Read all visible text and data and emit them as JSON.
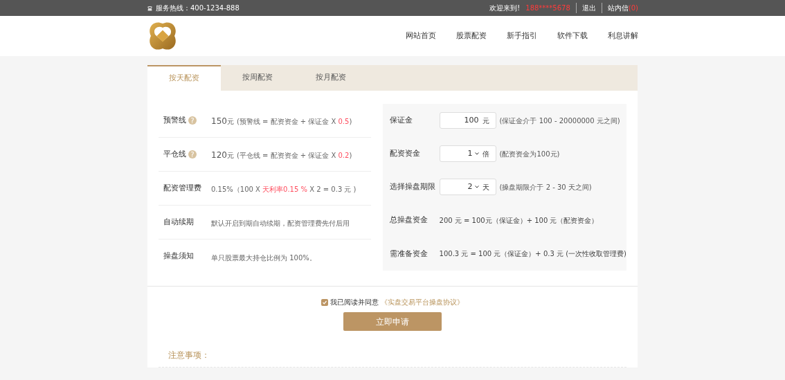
{
  "top_bar": {
    "hotline_label": "服务热线：",
    "hotline": "400-1234-888",
    "welcome": "欢迎来到!",
    "user": "188****5678",
    "logout": "退出",
    "inbox": "站内信",
    "inbox_count": "(0)"
  },
  "nav": [
    {
      "label": "网站首页"
    },
    {
      "label": "股票配资"
    },
    {
      "label": "新手指引"
    },
    {
      "label": "软件下载"
    },
    {
      "label": "利息讲解"
    }
  ],
  "tabs": [
    {
      "label": "按天配资",
      "selected": true
    },
    {
      "label": "按周配资",
      "selected": false
    },
    {
      "label": "按月配资",
      "selected": false
    }
  ],
  "info_rows": [
    {
      "label": "预警线",
      "help": "?",
      "segments": [
        {
          "kind": "amount",
          "text": "150"
        },
        {
          "kind": "unit",
          "text": "元"
        },
        {
          "kind": "note",
          "text": "(预警线 = 配资资金 + 保证金 X "
        },
        {
          "kind": "red",
          "text": "0.5"
        },
        {
          "kind": "note",
          "text": ")"
        }
      ]
    },
    {
      "label": "平仓线",
      "help": "?",
      "segments": [
        {
          "kind": "amount",
          "text": "120"
        },
        {
          "kind": "unit",
          "text": "元"
        },
        {
          "kind": "note",
          "text": "(平仓线 = 配资资金 + 保证金 X "
        },
        {
          "kind": "red",
          "text": "0.2"
        },
        {
          "kind": "note",
          "text": ")"
        }
      ]
    },
    {
      "label": "配资管理费",
      "segments": [
        {
          "kind": "plain",
          "text": "0.15%"
        },
        {
          "kind": "plain",
          "text": "（100 X "
        },
        {
          "kind": "red",
          "text": "天利率0.15 %"
        },
        {
          "kind": "plain",
          "text": " X 2 = 0.3 元 )"
        }
      ]
    },
    {
      "label": "自动续期",
      "segments": [
        {
          "kind": "plain",
          "text": "默认开启到期自动续期，配资管理费先付后用"
        }
      ]
    },
    {
      "label": "操盘须知",
      "segments": [
        {
          "kind": "plain",
          "text": "单只股票最大持仓比例为 100%。"
        }
      ]
    }
  ],
  "form_rows": [
    {
      "kind": "input",
      "label": "保证金",
      "value": "100",
      "unit": "元",
      "hint": "(保证金介于 100 - 20000000 元之间)"
    },
    {
      "kind": "select",
      "label": "配资资金",
      "value": "1",
      "unit": "倍",
      "hint": "(配资资金为100元)"
    },
    {
      "kind": "select",
      "label": "选择操盘期限",
      "value": "2",
      "unit": "天",
      "hint": "(操盘期限介于 2 - 30 天之间)"
    },
    {
      "kind": "text",
      "label": "总操盘资金",
      "text": "200 元 = 100元（保证金）+ 100 元（配资资金）"
    },
    {
      "kind": "text",
      "label": "需准备资金",
      "text": "100.3 元 = 100 元（保证金）+ 0.3 元 (一次性收取管理费)"
    }
  ],
  "agreement": {
    "checked": true,
    "text": "我已阅读并同意",
    "link": "《实盘交易平台操盘协议》"
  },
  "submit": "立即申请",
  "notes_title": "注意事项："
}
